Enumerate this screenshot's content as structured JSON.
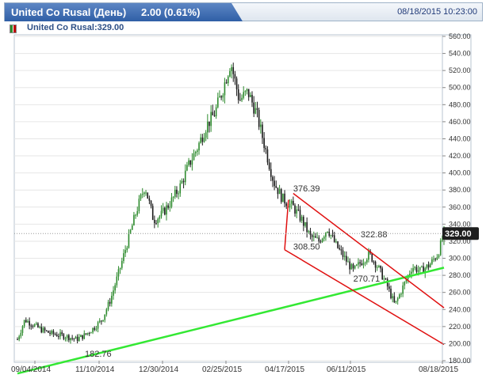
{
  "header": {
    "title": "United Co Rusal (День)",
    "change": "2.00 (0.61%)",
    "datetime": "08/18/2015 10:23:00"
  },
  "legend": {
    "label": "United Co Rusal:329.00"
  },
  "price_badge": "329.00",
  "chart_data": {
    "type": "candlestick",
    "title": "United Co Rusal (День)",
    "ylim": [
      180,
      560
    ],
    "y_ticks": [
      180,
      200,
      220,
      240,
      260,
      280,
      300,
      320,
      340,
      360,
      380,
      400,
      420,
      440,
      460,
      480,
      500,
      520,
      540,
      560
    ],
    "y_tick_labels": [
      "180.00",
      "200.00",
      "220.00",
      "240.00",
      "260.00",
      "280.00",
      "300.00",
      "320.00",
      "340.00",
      "360.00",
      "380.00",
      "400.00",
      "420.00",
      "440.00",
      "460.00",
      "480.00",
      "500.00",
      "520.00",
      "540.00",
      "560.00"
    ],
    "x_tick_labels": [
      "09/04/2014",
      "11/10/2014",
      "12/30/2014",
      "02/25/2015",
      "04/17/2015",
      "06/11/2015",
      "08/18/2015"
    ],
    "last_price": 329.0,
    "current_price_line": 329.0,
    "close_path": [
      {
        "date": "2014-09-04",
        "value": 205
      },
      {
        "date": "2014-09-10",
        "value": 228
      },
      {
        "date": "2014-09-17",
        "value": 222
      },
      {
        "date": "2014-09-24",
        "value": 216
      },
      {
        "date": "2014-10-01",
        "value": 212
      },
      {
        "date": "2014-10-08",
        "value": 210
      },
      {
        "date": "2014-10-15",
        "value": 208
      },
      {
        "date": "2014-10-22",
        "value": 205
      },
      {
        "date": "2014-10-29",
        "value": 210
      },
      {
        "date": "2014-11-05",
        "value": 218
      },
      {
        "date": "2014-11-12",
        "value": 228
      },
      {
        "date": "2014-11-19",
        "value": 252
      },
      {
        "date": "2014-11-26",
        "value": 285
      },
      {
        "date": "2014-12-03",
        "value": 320
      },
      {
        "date": "2014-12-10",
        "value": 355
      },
      {
        "date": "2014-12-17",
        "value": 385
      },
      {
        "date": "2014-12-24",
        "value": 345
      },
      {
        "date": "2014-12-30",
        "value": 350
      },
      {
        "date": "2015-01-08",
        "value": 368
      },
      {
        "date": "2015-01-15",
        "value": 385
      },
      {
        "date": "2015-01-22",
        "value": 410
      },
      {
        "date": "2015-01-29",
        "value": 430
      },
      {
        "date": "2015-02-05",
        "value": 455
      },
      {
        "date": "2015-02-12",
        "value": 470
      },
      {
        "date": "2015-02-19",
        "value": 500
      },
      {
        "date": "2015-02-25",
        "value": 530
      },
      {
        "date": "2015-03-04",
        "value": 485
      },
      {
        "date": "2015-03-11",
        "value": 495
      },
      {
        "date": "2015-03-18",
        "value": 470
      },
      {
        "date": "2015-03-25",
        "value": 430
      },
      {
        "date": "2015-04-01",
        "value": 390
      },
      {
        "date": "2015-04-08",
        "value": 370
      },
      {
        "date": "2015-04-17",
        "value": 360
      },
      {
        "date": "2015-04-24",
        "value": 345
      },
      {
        "date": "2015-05-01",
        "value": 325
      },
      {
        "date": "2015-05-08",
        "value": 320
      },
      {
        "date": "2015-05-15",
        "value": 335
      },
      {
        "date": "2015-05-22",
        "value": 315
      },
      {
        "date": "2015-05-29",
        "value": 300
      },
      {
        "date": "2015-06-05",
        "value": 285
      },
      {
        "date": "2015-06-11",
        "value": 295
      },
      {
        "date": "2015-06-18",
        "value": 305
      },
      {
        "date": "2015-06-25",
        "value": 290
      },
      {
        "date": "2015-07-02",
        "value": 270
      },
      {
        "date": "2015-07-09",
        "value": 245
      },
      {
        "date": "2015-07-16",
        "value": 268
      },
      {
        "date": "2015-07-23",
        "value": 290
      },
      {
        "date": "2015-07-30",
        "value": 285
      },
      {
        "date": "2015-08-06",
        "value": 292
      },
      {
        "date": "2015-08-13",
        "value": 305
      },
      {
        "date": "2015-08-18",
        "value": 329
      }
    ],
    "trend_lines": [
      {
        "name": "support",
        "color": "#33e833",
        "from": {
          "date": "2014-09-04",
          "value": 165
        },
        "to": {
          "date": "2015-08-18",
          "value": 289
        }
      },
      {
        "name": "channel-upper",
        "color": "#e01010",
        "from": {
          "date": "2015-04-17",
          "value": 376
        },
        "to": {
          "date": "2015-08-18",
          "value": 242
        }
      },
      {
        "name": "channel-lower",
        "color": "#e01010",
        "from": {
          "date": "2015-04-10",
          "value": 310
        },
        "to": {
          "date": "2015-08-18",
          "value": 199
        }
      }
    ],
    "annotations": [
      {
        "text": "182.76",
        "date": "2014-10-29",
        "value": 182.76
      },
      {
        "text": "376.39",
        "date": "2015-04-17",
        "value": 376.39
      },
      {
        "text": "308.50",
        "date": "2015-04-17",
        "value": 308.5
      },
      {
        "text": "322.88",
        "date": "2015-06-11",
        "value": 322.88
      },
      {
        "text": "270.71",
        "date": "2015-06-05",
        "value": 270.71
      }
    ],
    "colors": {
      "up": "#2e8b2e",
      "down": "#1a1a1a",
      "grid": "#e6e6e6",
      "axis_text": "#333333"
    }
  }
}
